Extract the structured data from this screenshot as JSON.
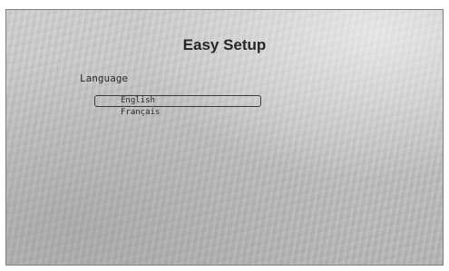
{
  "screen": {
    "title": "Easy Setup",
    "section_label": "Language",
    "options": [
      {
        "label": "English",
        "selected": true
      },
      {
        "label": "Français",
        "selected": false
      }
    ]
  }
}
